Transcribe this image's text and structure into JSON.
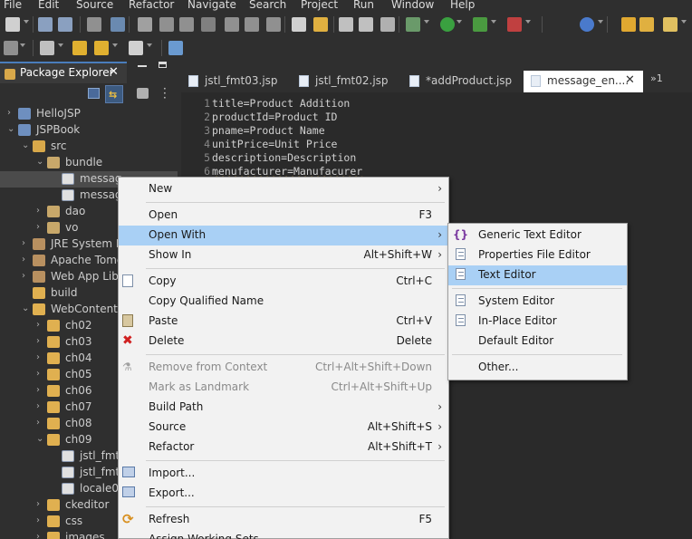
{
  "menubar": {
    "items": [
      "File",
      "Edit",
      "Source",
      "Refactor",
      "Navigate",
      "Search",
      "Project",
      "Run",
      "Window",
      "Help"
    ]
  },
  "package_explorer": {
    "title": "Package Explorer",
    "close": "✕"
  },
  "tree": [
    {
      "label": "HelloJSP",
      "twisty": "›",
      "icon": "project-icon",
      "color": "#6e8fbf"
    },
    {
      "label": "JSPBook",
      "twisty": "⌄",
      "icon": "project-icon",
      "color": "#6e8fbf"
    },
    {
      "label": "src",
      "twisty": "⌄",
      "icon": "source-folder-icon",
      "color": "#d8a84a"
    },
    {
      "label": "bundle",
      "twisty": "⌄",
      "icon": "package-icon",
      "color": "#c8a86a"
    },
    {
      "label": "messag",
      "twisty": "",
      "icon": "properties-file-icon",
      "color": "#e0e0e0"
    },
    {
      "label": "messag",
      "twisty": "",
      "icon": "properties-file-icon",
      "color": "#e0e0e0"
    },
    {
      "label": "dao",
      "twisty": "›",
      "icon": "package-icon",
      "color": "#c8a86a"
    },
    {
      "label": "vo",
      "twisty": "›",
      "icon": "package-icon",
      "color": "#c8a86a"
    },
    {
      "label": "JRE System Li",
      "twisty": "›",
      "icon": "library-icon",
      "color": "#b89060"
    },
    {
      "label": "Apache Tomc",
      "twisty": "›",
      "icon": "library-icon",
      "color": "#b89060"
    },
    {
      "label": "Web App Libr",
      "twisty": "›",
      "icon": "library-icon",
      "color": "#b89060"
    },
    {
      "label": "build",
      "twisty": "",
      "icon": "folder-icon",
      "color": "#e0b050"
    },
    {
      "label": "WebContent",
      "twisty": "⌄",
      "icon": "folder-icon",
      "color": "#e0b050"
    },
    {
      "label": "ch02",
      "twisty": "›",
      "icon": "folder-icon",
      "color": "#e0b050"
    },
    {
      "label": "ch03",
      "twisty": "›",
      "icon": "folder-icon",
      "color": "#e0b050"
    },
    {
      "label": "ch04",
      "twisty": "›",
      "icon": "folder-icon",
      "color": "#e0b050"
    },
    {
      "label": "ch05",
      "twisty": "›",
      "icon": "folder-icon",
      "color": "#e0b050"
    },
    {
      "label": "ch06",
      "twisty": "›",
      "icon": "folder-icon",
      "color": "#e0b050"
    },
    {
      "label": "ch07",
      "twisty": "›",
      "icon": "folder-icon",
      "color": "#e0b050"
    },
    {
      "label": "ch08",
      "twisty": "›",
      "icon": "folder-icon",
      "color": "#e0b050"
    },
    {
      "label": "ch09",
      "twisty": "⌄",
      "icon": "folder-icon",
      "color": "#e0b050"
    },
    {
      "label": "jstl_fmt",
      "twisty": "",
      "icon": "jsp-file-icon",
      "color": "#e0e0e0"
    },
    {
      "label": "jstl_fmt",
      "twisty": "",
      "icon": "jsp-file-icon",
      "color": "#e0e0e0"
    },
    {
      "label": "locale01",
      "twisty": "",
      "icon": "jsp-file-icon",
      "color": "#e0e0e0"
    },
    {
      "label": "ckeditor",
      "twisty": "›",
      "icon": "folder-icon",
      "color": "#e0b050"
    },
    {
      "label": "css",
      "twisty": "›",
      "icon": "folder-icon",
      "color": "#e0b050"
    },
    {
      "label": "images",
      "twisty": "›",
      "icon": "folder-icon",
      "color": "#e0b050"
    }
  ],
  "editor_tabs": [
    "jstl_fmt03.jsp",
    "jstl_fmt02.jsp",
    "*addProduct.jsp",
    "message_en...."
  ],
  "editor_tab_close": "✕",
  "editor_tab_more": "»1",
  "code": [
    {
      "n": "1",
      "text": "title=Product Addition"
    },
    {
      "n": "2",
      "text": "productId=Product ID"
    },
    {
      "n": "3",
      "text": "pname=Product Name"
    },
    {
      "n": "4",
      "text": "unitPrice=Unit Price"
    },
    {
      "n": "5",
      "text": "description=Description"
    },
    {
      "n": "6",
      "text": "menufacturer=Manufacurer"
    }
  ],
  "context_menu": [
    {
      "label": "New",
      "shortcut": "",
      "submenu": true
    },
    {
      "sep": true
    },
    {
      "label": "Open",
      "shortcut": "F3"
    },
    {
      "label": "Open With",
      "shortcut": "",
      "submenu": true,
      "highlight": true
    },
    {
      "label": "Show In",
      "shortcut": "Alt+Shift+W",
      "submenu": true
    },
    {
      "sep": true
    },
    {
      "label": "Copy",
      "shortcut": "Ctrl+C",
      "icon": "copy-icon"
    },
    {
      "label": "Copy Qualified Name",
      "shortcut": ""
    },
    {
      "label": "Paste",
      "shortcut": "Ctrl+V",
      "icon": "paste-icon"
    },
    {
      "label": "Delete",
      "shortcut": "Delete",
      "icon": "delete-icon"
    },
    {
      "sep": true
    },
    {
      "label": "Remove from Context",
      "shortcut": "Ctrl+Alt+Shift+Down",
      "disabled": true,
      "icon": "remove-context-icon"
    },
    {
      "label": "Mark as Landmark",
      "shortcut": "Ctrl+Alt+Shift+Up",
      "disabled": true
    },
    {
      "label": "Build Path",
      "shortcut": "",
      "submenu": true
    },
    {
      "label": "Source",
      "shortcut": "Alt+Shift+S",
      "submenu": true
    },
    {
      "label": "Refactor",
      "shortcut": "Alt+Shift+T",
      "submenu": true
    },
    {
      "sep": true
    },
    {
      "label": "Import...",
      "shortcut": "",
      "icon": "import-icon"
    },
    {
      "label": "Export...",
      "shortcut": "",
      "icon": "export-icon"
    },
    {
      "sep": true
    },
    {
      "label": "Refresh",
      "shortcut": "F5",
      "icon": "refresh-icon"
    },
    {
      "label": "Assign Working Sets...",
      "shortcut": ""
    }
  ],
  "open_with_menu": [
    {
      "label": "Generic Text Editor",
      "icon": "generic-editor-icon"
    },
    {
      "label": "Properties File Editor",
      "icon": "properties-editor-icon"
    },
    {
      "label": "Text Editor",
      "icon": "text-editor-icon",
      "highlight": true
    },
    {
      "sep": true
    },
    {
      "label": "System Editor",
      "icon": "system-editor-icon"
    },
    {
      "label": "In-Place Editor",
      "icon": "inplace-editor-icon"
    },
    {
      "label": "Default Editor",
      "icon": ""
    },
    {
      "sep": true
    },
    {
      "label": "Other..."
    }
  ]
}
